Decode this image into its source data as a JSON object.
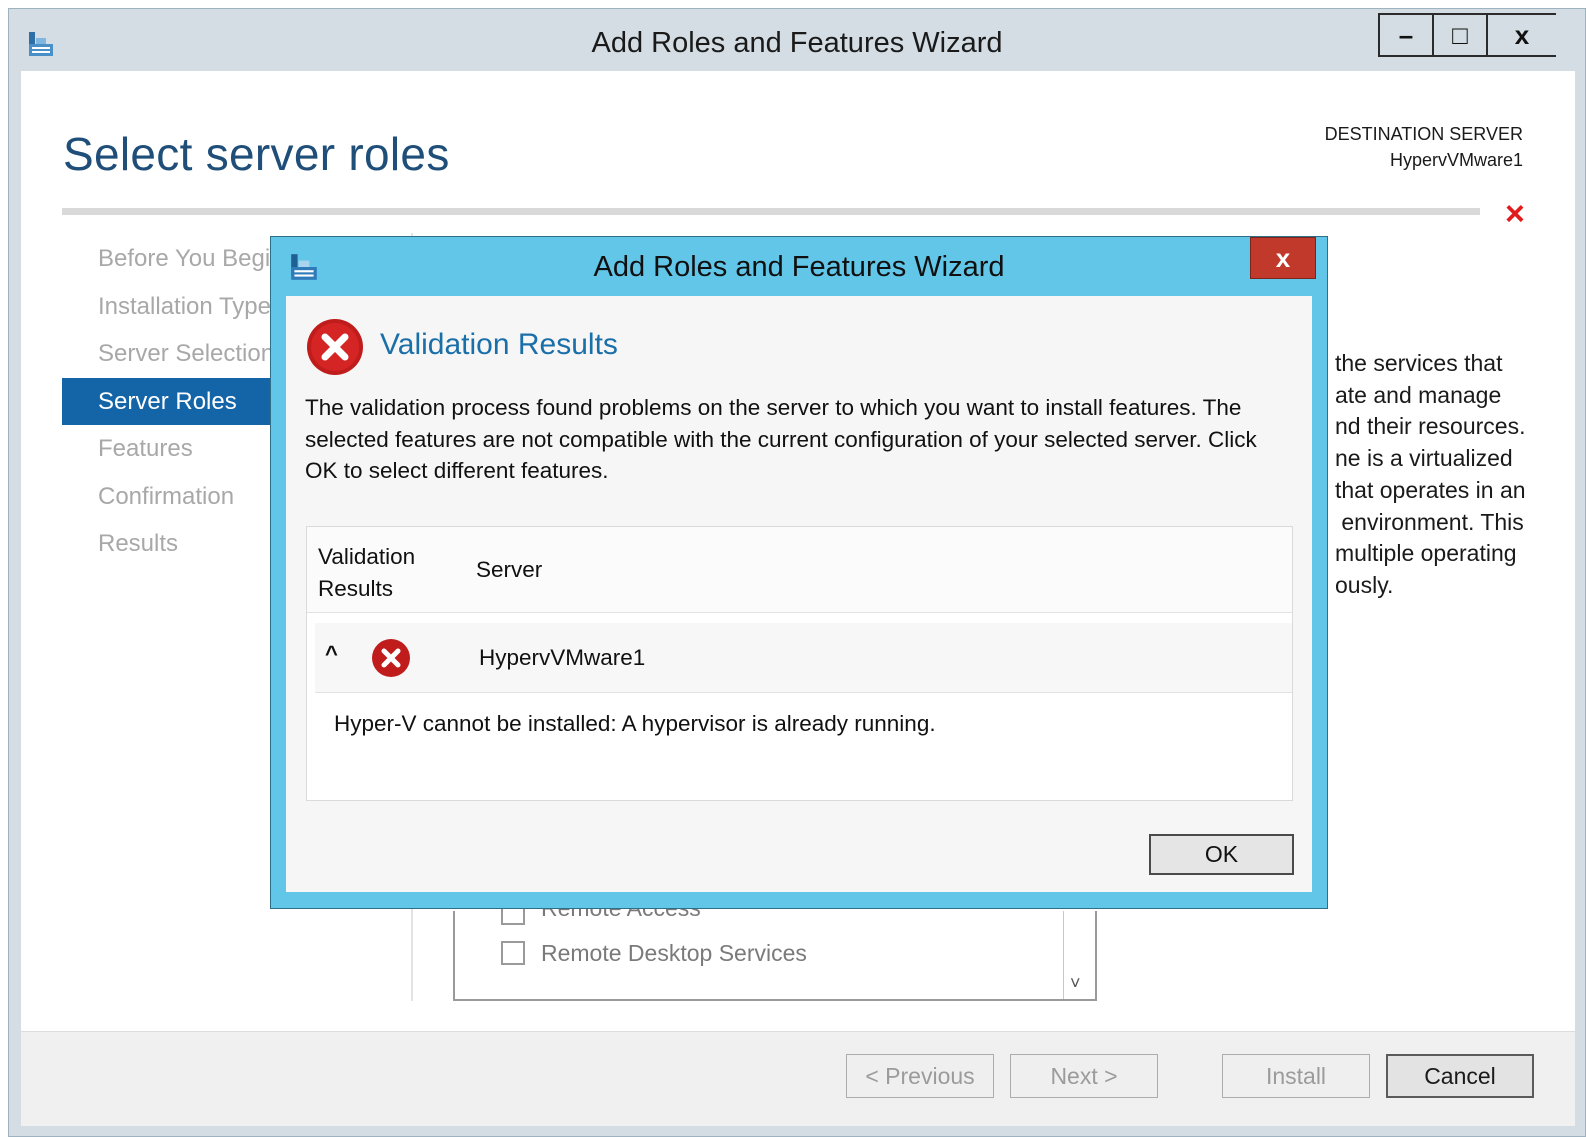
{
  "window": {
    "title": "Add Roles and Features Wizard",
    "controls": {
      "minimize": "–",
      "maximize": "□",
      "close": "x"
    }
  },
  "page": {
    "title": "Select server roles",
    "destination_label": "DESTINATION SERVER",
    "destination_name": "HypervVMware1",
    "error_marker": "×"
  },
  "nav": {
    "items": [
      {
        "label": "Before You Begin"
      },
      {
        "label": "Installation Type"
      },
      {
        "label": "Server Selection"
      },
      {
        "label": "Server Roles",
        "active": true
      },
      {
        "label": "Features"
      },
      {
        "label": "Confirmation"
      },
      {
        "label": "Results"
      }
    ]
  },
  "description": {
    "lines": [
      "the services that",
      "ate and manage",
      "nd their resources.",
      "ne is a virtualized",
      "that operates in an",
      " environment. This",
      "multiple operating",
      "ously."
    ]
  },
  "roles": {
    "items": [
      "Remote Access",
      "Remote Desktop Services"
    ],
    "scroll_down": "˅"
  },
  "footer": {
    "previous": "< Previous",
    "next": "Next >",
    "install": "Install",
    "cancel": "Cancel"
  },
  "dialog": {
    "title": "Add Roles and Features Wizard",
    "close": "x",
    "heading": "Validation Results",
    "message": "The validation process found problems on the server to which you want to install features. The selected features are not compatible with the current configuration of your selected server.  Click OK to select different features.",
    "table": {
      "col_validation": "Validation Results",
      "col_server": "Server",
      "row_chevron": "^",
      "row_server": "HypervVMware1",
      "row_detail": "Hyper-V cannot be installed: A hypervisor is already running."
    },
    "ok": "OK"
  },
  "colors": {
    "accent_blue": "#1464a8",
    "dialog_frame": "#62c6e8",
    "heading_blue": "#1b6fa9",
    "error_red": "#c01c1c"
  }
}
